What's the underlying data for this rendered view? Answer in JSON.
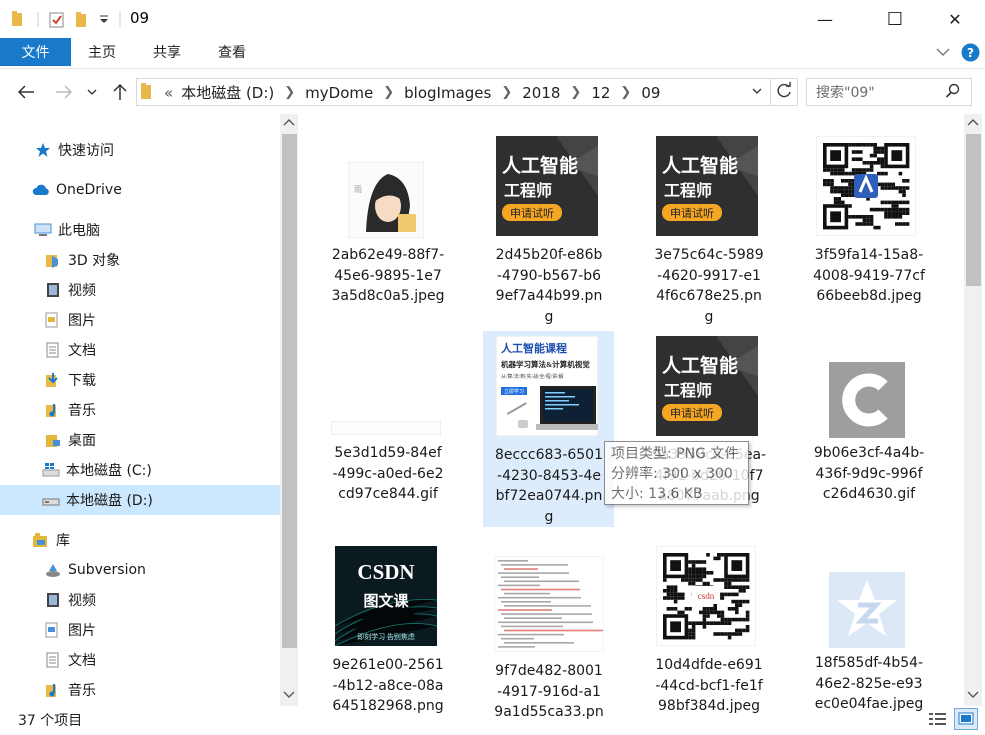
{
  "window": {
    "title": "09",
    "controls": [
      "—",
      "☐",
      "✕"
    ]
  },
  "ribbon": {
    "file": "文件",
    "tabs": [
      "主页",
      "共享",
      "查看"
    ]
  },
  "address": {
    "prefix": "«",
    "crumbs": [
      "本地磁盘 (D:)",
      "myDome",
      "blogImages",
      "2018",
      "12",
      "09"
    ]
  },
  "search": {
    "placeholder": "搜索\"09\""
  },
  "nav": [
    {
      "label": "快速访问",
      "icon": "star-icon",
      "color": "#1979ca"
    },
    {
      "label": "OneDrive",
      "icon": "cloud-icon",
      "color": "#1979ca"
    },
    {
      "label": "此电脑",
      "icon": "computer-icon",
      "color": "#4a90d9"
    },
    {
      "label": "3D 对象",
      "icon": "cube-folder-icon",
      "color": "#4a90d9"
    },
    {
      "label": "视频",
      "icon": "video-icon",
      "color": "#444444"
    },
    {
      "label": "图片",
      "icon": "pictures-icon",
      "color": "#e2b73a"
    },
    {
      "label": "文档",
      "icon": "documents-icon",
      "color": "#8a8a8a"
    },
    {
      "label": "下载",
      "icon": "download-icon",
      "color": "#1979ca"
    },
    {
      "label": "音乐",
      "icon": "music-icon",
      "color": "#1979ca"
    },
    {
      "label": "桌面",
      "icon": "desktop-folder-icon",
      "color": "#e2b73a"
    },
    {
      "label": "本地磁盘 (C:)",
      "icon": "windows-drive-icon",
      "color": "#1979ca"
    },
    {
      "label": "本地磁盘 (D:)",
      "icon": "drive-icon",
      "color": "#777777"
    },
    {
      "label": "库",
      "icon": "library-icon",
      "color": "#e2b73a"
    },
    {
      "label": "Subversion",
      "icon": "subversion-icon",
      "color": "#4a90d9"
    },
    {
      "label": "视频",
      "icon": "video-icon",
      "color": "#444444"
    },
    {
      "label": "图片",
      "icon": "pictures-icon",
      "color": "#4a90d9"
    },
    {
      "label": "文档",
      "icon": "documents-icon",
      "color": "#8a8a8a"
    },
    {
      "label": "音乐",
      "icon": "music-icon",
      "color": "#1979ca"
    }
  ],
  "files": [
    {
      "lines": [
        "2ab62e49-88f7-",
        "45e6-9895-1e7",
        "3a5d8c0a5.jpeg"
      ],
      "thumb": "anime-avatar"
    },
    {
      "lines": [
        "2d45b20f-e86b",
        "-4790-b567-b6",
        "9ef7a44b99.pn",
        "g"
      ],
      "thumb": "ai-banner",
      "text": [
        "人工智能",
        "工程师",
        "申请试听"
      ]
    },
    {
      "lines": [
        "3e75c64c-5989",
        "-4620-9917-e1",
        "4f6c678e25.pn",
        "g"
      ],
      "thumb": "ai-banner",
      "text": [
        "人工智能",
        "工程师",
        "申请试听"
      ]
    },
    {
      "lines": [
        "3f59fa14-15a8-",
        "4008-9419-77cf",
        "66beeb8d.jpeg"
      ],
      "thumb": "qr-code"
    },
    {
      "lines": [
        "5e3d1d59-84ef",
        "-499c-a0ed-6e2",
        "cd97ce844.gif"
      ],
      "thumb": "thin-bar"
    },
    {
      "lines": [
        "8eccc683-6501",
        "-4230-8453-4e",
        "bf72ea0744.pn",
        "g"
      ],
      "thumb": "course-banner",
      "text": [
        "人工智能课程",
        "机器学习算法&计算机视觉",
        "从/算/法/到/实/战/全/程/讲/解",
        "立即学习"
      ]
    },
    {
      "lines": [
        "9a3958ca-e5ea-",
        "4f91-bd29-10f7",
        "a8077aab.png"
      ],
      "thumb": "ai-banner",
      "text": [
        "人工智能",
        "工程师",
        "申请试听"
      ]
    },
    {
      "lines": [
        "9b06e3cf-4a4b-",
        "436f-9d9c-996f",
        "c26d4630.gif"
      ],
      "thumb": "c-logo"
    },
    {
      "lines": [
        "9e261e00-2561",
        "-4b12-a8ce-08a",
        "645182968.png"
      ],
      "thumb": "csdn-banner",
      "text": [
        "CSDN",
        "图文课",
        "即刻学习  告别焦虑"
      ]
    },
    {
      "lines": [
        "9f7de482-8001",
        "-4917-916d-a1",
        "9a1d55ca33.pn"
      ],
      "thumb": "code-doc"
    },
    {
      "lines": [
        "10d4dfde-e691",
        "-44cd-bcf1-fe1f",
        "98bf384d.jpeg"
      ],
      "thumb": "qr-code-csdn",
      "text": [
        "csdn"
      ]
    },
    {
      "lines": [
        "18f585df-4b54-",
        "46e2-825e-e93",
        "ec0e04fae.jpeg"
      ],
      "thumb": "z-logo"
    }
  ],
  "tooltip": {
    "lines": [
      "项目类型: PNG 文件",
      "分辨率: 300 x 300",
      "大小: 13.6 KB"
    ]
  },
  "status": {
    "count": "37 个项目"
  },
  "colors": {
    "accent": "#1979ca",
    "selection": "#cce8ff",
    "banner_orange": "#f5a623",
    "banner_dark": "#2b2b2b"
  }
}
